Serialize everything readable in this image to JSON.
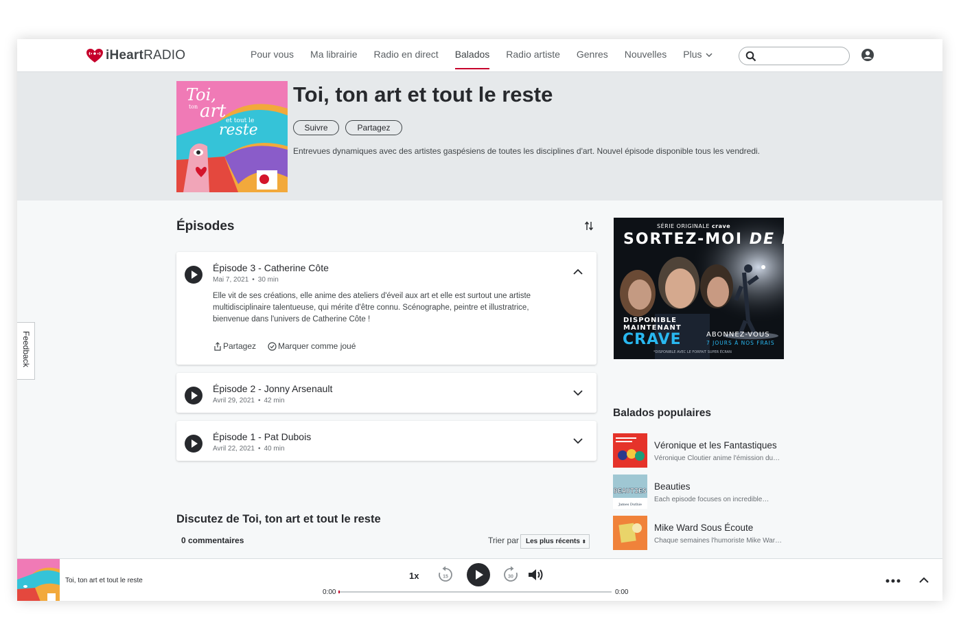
{
  "brand": {
    "logo_text_bold": "iHeart",
    "logo_text": "RADIO",
    "accent_color": "#c6002b"
  },
  "nav": {
    "items": [
      {
        "label": "Pour vous"
      },
      {
        "label": "Ma librairie"
      },
      {
        "label": "Radio en direct"
      },
      {
        "label": "Balados",
        "active": true
      },
      {
        "label": "Radio artiste"
      },
      {
        "label": "Genres"
      },
      {
        "label": "Nouvelles"
      },
      {
        "label": "Plus"
      }
    ],
    "search_placeholder": "",
    "icons": [
      "search-icon",
      "user-icon",
      "chevron-down-icon"
    ]
  },
  "podcast": {
    "title": "Toi, ton art et tout le reste",
    "follow_label": "Suivre",
    "share_label": "Partagez",
    "description": "Entrevues dynamiques avec des artistes gaspésiens de toutes les disciplines d'art. Nouvel épisode disponible tous les vendredi.",
    "cover_text": {
      "line1": "Toi,",
      "line2": "ton",
      "line3": "art",
      "line4": "et tout le",
      "line5": "reste"
    }
  },
  "episodes": {
    "heading": "Épisodes",
    "items": [
      {
        "title": "Épisode 3 - Catherine Côte",
        "date": "Mai 7, 2021",
        "duration": "30 min",
        "expanded": true,
        "description": "Elle vit de ses créations, elle anime des ateliers d'éveil aux art et elle est surtout une artiste multidisciplinaire talentueuse, qui mérite d'être connu. Scénographe, peintre et illustratrice, bienvenue dans l'univers de Catherine Côte !",
        "share_label": "Partagez",
        "mark_played_label": "Marquer comme joué"
      },
      {
        "title": "Épisode 2 - Jonny Arsenault",
        "date": "Avril 29, 2021",
        "duration": "42 min",
        "expanded": false
      },
      {
        "title": "Épisode 1 - Pat Dubois",
        "date": "Avril 22, 2021",
        "duration": "40 min",
        "expanded": false
      }
    ]
  },
  "discussion": {
    "title": "Discutez de Toi, ton art et tout le reste",
    "comment_count": "0 commentaires",
    "sort_label": "Trier par",
    "sort_value": "Les plus récents"
  },
  "ad": {
    "kicker_prefix": "SÉRIE ORIGINALE",
    "kicker_brand": "crave",
    "headline_a": "SORTEZ-MOI",
    "headline_b": "DE MOI",
    "available_line1": "DISPONIBLE",
    "available_line2": "MAINTENANT",
    "brand_big": "CRAVE",
    "subscribe": "ABONNEZ-VOUS",
    "subscribe_sub": "7 JOURS À NOS FRAIS",
    "fine_print": "*DISPONIBLE AVEC LE FORFAIT SUPER ÉCRAN"
  },
  "popular": {
    "title": "Balados populaires",
    "items": [
      {
        "name": "Véronique et les Fantastiques",
        "sub": "Véronique Cloutier anime l'émission du…",
        "thumb_color": "#e5332a"
      },
      {
        "name": "Beauties",
        "sub": "Each episode focuses on incredible…",
        "thumb_color": "#9fc7d3",
        "thumb_text": "BEAUTIES",
        "thumb_caption": "James Duthie"
      },
      {
        "name": "Mike Ward Sous Écoute",
        "sub": "Chaque semaines l'humoriste Mike War…",
        "thumb_color": "#f0823a"
      }
    ]
  },
  "feedback": {
    "label": "Feedback"
  },
  "player": {
    "title": "Toi, ton art et tout le reste",
    "speed": "1x",
    "skip_back": "15",
    "skip_forward": "30",
    "time_current": "0:00",
    "time_total": "0:00",
    "progress": 0.0
  }
}
